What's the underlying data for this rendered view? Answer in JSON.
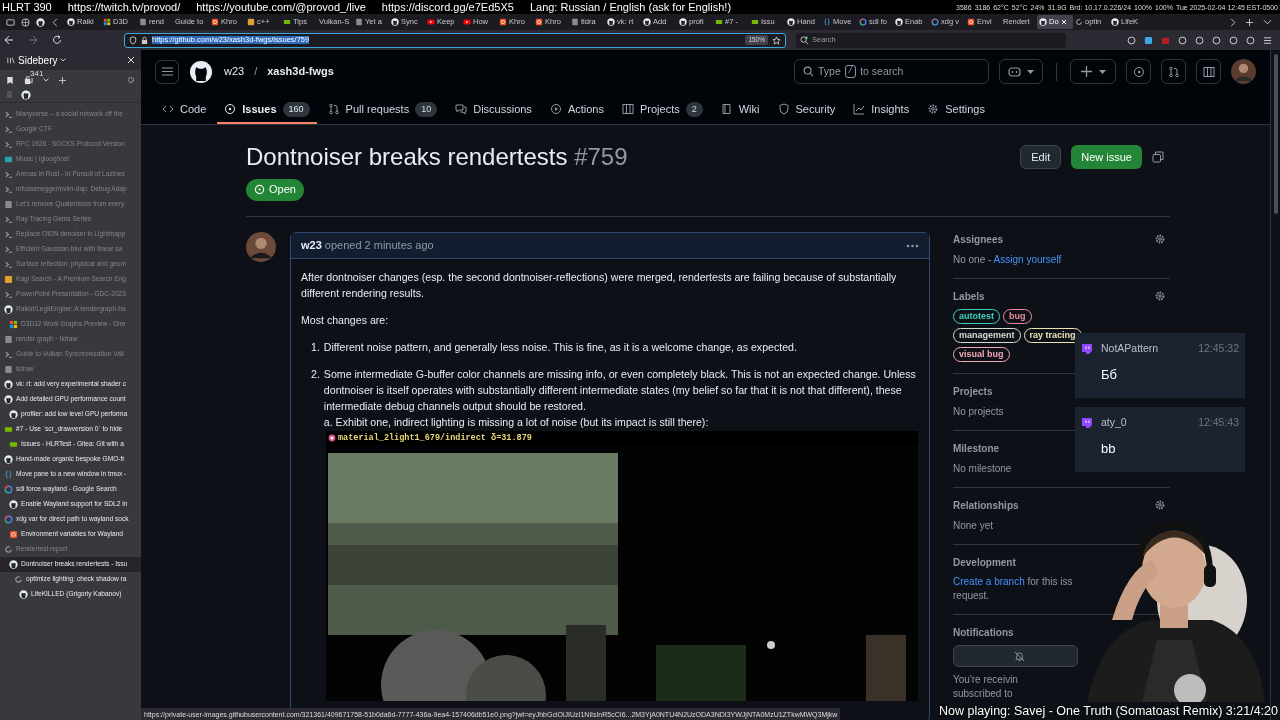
{
  "stream_overlay": {
    "items": [
      "HLRT 390",
      "https://twitch.tv/provod/",
      "https://youtube.com/@provod_/live",
      "https://discord.gg/e7Ed5X5",
      "Lang: Russian / English (ask for English!)"
    ],
    "tray": [
      "3586",
      "3186",
      "62°C",
      "52°C",
      "24%",
      "31.9G",
      "Brd: 10.17.0.226/24",
      "100%",
      "100%",
      "Tue 2025-02-04 12:45 EST-0500"
    ]
  },
  "browser": {
    "tabs": [
      {
        "title": "Raiki",
        "kind": "github",
        "selected": false
      },
      {
        "title": "D3D",
        "kind": "windows",
        "selected": false
      },
      {
        "title": "rend",
        "kind": "page",
        "selected": false
      },
      {
        "title": "Guide to",
        "kind": "none",
        "selected": false
      },
      {
        "title": "Khro",
        "kind": "ubuntu",
        "selected": false
      },
      {
        "title": "c++",
        "kind": "kagi",
        "selected": false
      },
      {
        "title": "Tips",
        "kind": "nvidia",
        "selected": false
      },
      {
        "title": "Vulkan-S",
        "kind": "none",
        "selected": false
      },
      {
        "title": "Yet a",
        "kind": "page",
        "selected": false
      },
      {
        "title": "Sync",
        "kind": "github",
        "selected": false
      },
      {
        "title": "Keep",
        "kind": "youtube",
        "selected": false
      },
      {
        "title": "How",
        "kind": "youtube",
        "selected": false
      },
      {
        "title": "Khro",
        "kind": "ubuntu",
        "selected": false
      },
      {
        "title": "Khro",
        "kind": "ubuntu",
        "selected": false
      },
      {
        "title": "tldra",
        "kind": "page",
        "selected": false
      },
      {
        "title": "vk: rt",
        "kind": "github",
        "selected": false
      },
      {
        "title": "Add",
        "kind": "github",
        "selected": false
      },
      {
        "title": "profi",
        "kind": "github",
        "selected": false
      },
      {
        "title": "#7 -",
        "kind": "nvidia",
        "selected": false
      },
      {
        "title": "Issu",
        "kind": "nvidia",
        "selected": false
      },
      {
        "title": "Hand",
        "kind": "github",
        "selected": false
      },
      {
        "title": "Move",
        "kind": "tmux",
        "selected": false
      },
      {
        "title": "sdl fo",
        "kind": "google",
        "selected": false
      },
      {
        "title": "Enab",
        "kind": "github",
        "selected": false
      },
      {
        "title": "xdg v",
        "kind": "google",
        "selected": false
      },
      {
        "title": "Envi",
        "kind": "ubuntu",
        "selected": false
      },
      {
        "title": "Rendert",
        "kind": "none",
        "selected": false
      },
      {
        "title": "Do",
        "kind": "github",
        "selected": true
      },
      {
        "title": "optin",
        "kind": "reload",
        "selected": false
      },
      {
        "title": "LifeK",
        "kind": "github",
        "selected": false
      }
    ],
    "url": "https://github.com/w23/xash3d-fwgs/issues/759",
    "zoom": "150%",
    "search_placeholder": "Search"
  },
  "sidebery": {
    "title": "Sidebery",
    "tab_count": "341",
    "items": [
      {
        "title": "Manyverse – a social network off the",
        "kind": "chevron",
        "dimmed": true,
        "selected": false
      },
      {
        "title": "Google CTF",
        "kind": "chevron",
        "dimmed": true,
        "selected": false
      },
      {
        "title": "RFC 1928 - SOCKS Protocol Version",
        "kind": "chevron",
        "dimmed": true,
        "selected": false
      },
      {
        "title": "Music | Iglooghost",
        "kind": "music",
        "dimmed": true,
        "selected": false
      },
      {
        "title": "Arenas in Rust - In Pursuit of Lazines",
        "kind": "chevron",
        "dimmed": true,
        "selected": false
      },
      {
        "title": "mfussenegger/nvim-dap: Debug Adap",
        "kind": "chevron",
        "dimmed": true,
        "selected": false
      },
      {
        "title": "Let's remove Quaternions from every",
        "kind": "page",
        "dimmed": true,
        "selected": false
      },
      {
        "title": "Ray Tracing Gems Series",
        "kind": "chevron",
        "dimmed": true,
        "selected": false
      },
      {
        "title": "Replace OIDN denoiser in Lightmapp",
        "kind": "chevron",
        "dimmed": true,
        "selected": false
      },
      {
        "title": "Efficient Gaussian blur with linear sa",
        "kind": "chevron",
        "dimmed": true,
        "selected": false
      },
      {
        "title": "Surface reflection: physical and geom",
        "kind": "chevron",
        "dimmed": true,
        "selected": false
      },
      {
        "title": "Kagi Search - A Premium Search Eng",
        "kind": "kagi",
        "dimmed": true,
        "selected": false
      },
      {
        "title": "PowerPoint Presentation - GDC-2023",
        "kind": "chevron",
        "dimmed": true,
        "selected": false
      },
      {
        "title": "Raikiri/LegitEngine: A rendergraph-ba",
        "kind": "github",
        "dimmed": true,
        "selected": false,
        "children": [
          {
            "title": "D3D12 Work Graphs Preview - Dire",
            "kind": "windows",
            "dimmed": true,
            "selected": false
          }
        ]
      },
      {
        "title": "render graph · tldraw",
        "kind": "page",
        "dimmed": true,
        "selected": false
      },
      {
        "title": "Guide to Vulkan Synchronization Vali",
        "kind": "chevron",
        "dimmed": true,
        "selected": false
      },
      {
        "title": "tldraw",
        "kind": "page",
        "dimmed": true,
        "selected": false
      },
      {
        "title": "vk: rt: add very experimental shader c",
        "kind": "github",
        "dimmed": false,
        "selected": false
      },
      {
        "title": "Add detailed GPU performance count",
        "kind": "github",
        "dimmed": false,
        "selected": false,
        "children": [
          {
            "title": "profiler: add low level GPU performa",
            "kind": "github",
            "dimmed": false,
            "selected": false
          }
        ]
      },
      {
        "title": "#7 - Use `scr_drawversion 0` to hide",
        "kind": "nvidia",
        "dimmed": false,
        "selected": false,
        "children": [
          {
            "title": "Issues - HLRTest - Gitea: Git with a",
            "kind": "nvidia",
            "dimmed": false,
            "selected": false
          }
        ]
      },
      {
        "title": "Hand-made organic bespoke GMO-fr",
        "kind": "github",
        "dimmed": false,
        "selected": false
      },
      {
        "title": "Move pane to a new window in tmux -",
        "kind": "tmux",
        "dimmed": false,
        "selected": false
      },
      {
        "title": "sdl force wayland - Google Search",
        "kind": "google",
        "dimmed": false,
        "selected": false,
        "children": [
          {
            "title": "Enable Wayland support for SDL2 in",
            "kind": "github",
            "dimmed": false,
            "selected": false
          }
        ]
      },
      {
        "title": "xdg var for direct path to wayland sock",
        "kind": "google",
        "dimmed": false,
        "selected": false,
        "children": [
          {
            "title": "Environment variables for Wayland",
            "kind": "ubuntu",
            "dimmed": false,
            "selected": false
          }
        ]
      },
      {
        "title": "Rendertest report",
        "kind": "reload",
        "dimmed": true,
        "selected": false,
        "children": [
          {
            "title": "Dontnoiser breaks rendertests - Issu",
            "kind": "github",
            "dimmed": false,
            "selected": true,
            "children": [
              {
                "title": "optimize lighting: check shadow ra",
                "kind": "reload",
                "dimmed": false,
                "selected": false,
                "children": [
                  {
                    "title": "LifeKILLED (Grigoriy Kabanov)",
                    "kind": "github",
                    "dimmed": false,
                    "selected": false
                  }
                ]
              }
            ]
          }
        ]
      }
    ]
  },
  "repo": {
    "owner": "w23",
    "separator": "/",
    "name": "xash3d-fwgs",
    "search_before": "Type",
    "search_key": "/",
    "search_after": "to search"
  },
  "repo_tabs": [
    {
      "label": "Code",
      "selected": false
    },
    {
      "label": "Issues",
      "count": "160",
      "selected": true
    },
    {
      "label": "Pull requests",
      "count": "10",
      "selected": false
    },
    {
      "label": "Discussions",
      "selected": false
    },
    {
      "label": "Actions",
      "selected": false
    },
    {
      "label": "Projects",
      "count": "2",
      "selected": false
    },
    {
      "label": "Wiki",
      "selected": false
    },
    {
      "label": "Security",
      "selected": false
    },
    {
      "label": "Insights",
      "selected": false
    },
    {
      "label": "Settings",
      "selected": false
    }
  ],
  "issue": {
    "title": "Dontnoiser breaks rendertests",
    "number": "#759",
    "buttons": [
      "Edit",
      "New issue"
    ],
    "state": "Open"
  },
  "comment": {
    "author": "w23",
    "action": "opened",
    "time": "2 minutes ago",
    "paragraphs": [
      "After dontnoiser changes (esp. the second dontnoiser-reflections) were merged, rendertests are failing because of substantially different rendering results.",
      "Most changes are:"
    ],
    "list": [
      {
        "number": "1.",
        "text": "Different noise pattern, and generally less noise. This is fine, as it is a welcome change, as expected."
      },
      {
        "number": "2.",
        "text": "Some intermediate G-buffer color channels are missing info, or even completely black. This is not an expected change. Unless dontnoiser is itself operates with substantially different intermediate states (my belief so far that it is not that different), these intermediate debug channels output should be restored.",
        "note": "a. Exhibit one, indirect lighting is missing a lot of noise (but its impact is still there):"
      }
    ],
    "image_caption": "material_2light1_679/indirect δ=31.879"
  },
  "sidebar": [
    {
      "kind": "assignees",
      "heading": "Assignees",
      "settings": true,
      "text": "No one -",
      "link": "Assign yourself"
    },
    {
      "kind": "labels",
      "heading": "Labels",
      "settings": true,
      "labels": [
        {
          "name": "autotest",
          "color": "#3fd1c1"
        },
        {
          "name": "bug",
          "color": "#ee8a9c"
        },
        {
          "name": "management",
          "color": "#cfdccf"
        },
        {
          "name": "ray tracing",
          "color": "#ece3b4"
        },
        {
          "name": "visual bug",
          "color": "#f3a7b7"
        }
      ]
    },
    {
      "kind": "text",
      "heading": "Projects",
      "settings": false,
      "text": "No projects"
    },
    {
      "kind": "text",
      "heading": "Milestone",
      "settings": false,
      "text": "No milestone"
    },
    {
      "kind": "text",
      "heading": "Relationships",
      "settings": true,
      "text": "None yet"
    },
    {
      "kind": "development",
      "heading": "Development",
      "settings": false,
      "link": "Create a branch",
      "lines": [
        "for this iss",
        "request."
      ]
    },
    {
      "kind": "notifications",
      "heading": "Notifications",
      "settings": false,
      "lines": [
        "You're receivin",
        "subscribed to"
      ]
    }
  ],
  "chat": [
    {
      "user": "NotAPattern",
      "time": "12:45:32",
      "message": "Бб"
    },
    {
      "user": "aty_0",
      "time": "12:45:43",
      "message": "bb"
    }
  ],
  "status_url": "https://private-user-images.githubusercontent.com/321361/409671758-51b0da6d-7777-436a-9ea4-157406db51e0.png?jwt=eyJhbGciOiJIUzI1NiIsInR5cCI6...2M3YjA0NTU4N2UzODA3NDI3YWJjNTA0MzU1ZTkwMWQ3Mjkw",
  "now_playing": "Now playing: Savej - One Truth (Somatoast Remix) 3:21/4:20"
}
